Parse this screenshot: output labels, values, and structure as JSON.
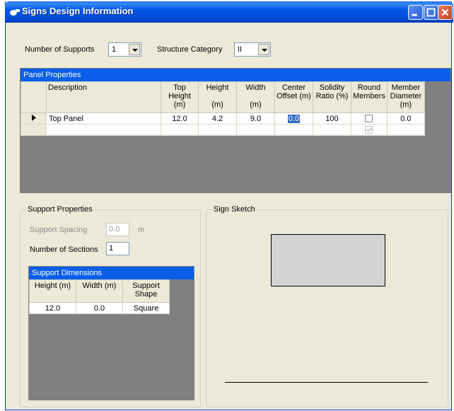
{
  "window": {
    "title": "Signs Design Information"
  },
  "top": {
    "supports_label": "Number of Supports",
    "supports_value": "1",
    "category_label": "Structure Category",
    "category_value": "II"
  },
  "panel": {
    "caption": "Panel Properties",
    "headers": {
      "description": "Description",
      "top_height": "Top Height (m)",
      "height": "Height",
      "height_unit": "(m)",
      "width": "Width",
      "width_unit": "(m)",
      "center_offset": "Center Offset (m)",
      "solidity": "Solidity Ratio (%)",
      "round": "Round Members",
      "diameter": "Member Diameter (m)"
    },
    "row": {
      "description": "Top Panel",
      "top_height": "12.0",
      "height": "4.2",
      "width": "9.0",
      "center_offset": "0.0",
      "solidity": "100",
      "diameter": "0.0"
    }
  },
  "support": {
    "legend": "Support Properties",
    "spacing_label": "Support Spacing",
    "spacing_value": "0.0",
    "spacing_unit": "m",
    "sections_label": "Number of Sections",
    "sections_value": "1",
    "dims_caption": "Support Dimensions",
    "dims_headers": {
      "height": "Height (m)",
      "width": "Width (m)",
      "shape": "Support Shape"
    },
    "dims_row": {
      "height": "12.0",
      "width": "0.0",
      "shape": "Square"
    }
  },
  "sketch": {
    "legend": "Sign Sketch"
  },
  "colors": {
    "title_bar": "#0058e6",
    "grid_caption": "#0a5ee8",
    "selection": "#316ac5",
    "sketch_panel_fill": "#d4d4d4"
  }
}
